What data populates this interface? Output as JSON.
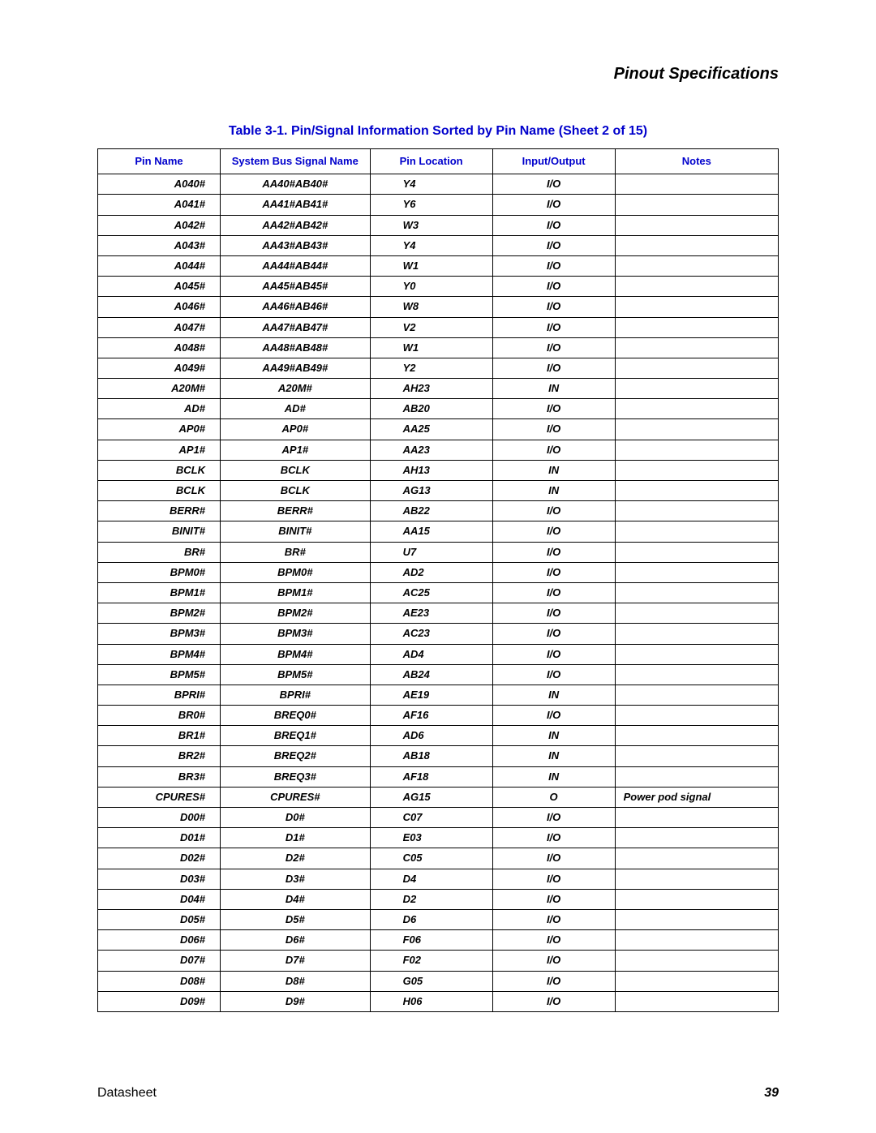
{
  "section_title": "Pinout Specifications",
  "table_caption": "Table 3-1. Pin/Signal Information Sorted by Pin Name (Sheet 2 of 15)",
  "headers": {
    "pin_name": "Pin Name",
    "signal": "System Bus Signal Name",
    "location": "Pin Location",
    "io": "Input/Output",
    "notes": "Notes"
  },
  "footer": {
    "left": "Datasheet",
    "right": "39"
  },
  "rows": [
    {
      "pin": "A040#",
      "sig": "AA40#AB40#",
      "loc": "Y4",
      "io": "I/O",
      "notes": ""
    },
    {
      "pin": "A041#",
      "sig": "AA41#AB41#",
      "loc": "Y6",
      "io": "I/O",
      "notes": ""
    },
    {
      "pin": "A042#",
      "sig": "AA42#AB42#",
      "loc": "W3",
      "io": "I/O",
      "notes": ""
    },
    {
      "pin": "A043#",
      "sig": "AA43#AB43#",
      "loc": "Y4",
      "io": "I/O",
      "notes": ""
    },
    {
      "pin": "A044#",
      "sig": "AA44#AB44#",
      "loc": "W1",
      "io": "I/O",
      "notes": ""
    },
    {
      "pin": "A045#",
      "sig": "AA45#AB45#",
      "loc": "Y0",
      "io": "I/O",
      "notes": ""
    },
    {
      "pin": "A046#",
      "sig": "AA46#AB46#",
      "loc": "W8",
      "io": "I/O",
      "notes": ""
    },
    {
      "pin": "A047#",
      "sig": "AA47#AB47#",
      "loc": "V2",
      "io": "I/O",
      "notes": ""
    },
    {
      "pin": "A048#",
      "sig": "AA48#AB48#",
      "loc": "W1",
      "io": "I/O",
      "notes": ""
    },
    {
      "pin": "A049#",
      "sig": "AA49#AB49#",
      "loc": "Y2",
      "io": "I/O",
      "notes": ""
    },
    {
      "pin": "A20M#",
      "sig": "A20M#",
      "loc": "AH23",
      "io": "IN",
      "notes": ""
    },
    {
      "pin": "AD#",
      "sig": "AD#",
      "loc": "AB20",
      "io": "I/O",
      "notes": ""
    },
    {
      "pin": "AP0#",
      "sig": "AP0#",
      "loc": "AA25",
      "io": "I/O",
      "notes": ""
    },
    {
      "pin": "AP1#",
      "sig": "AP1#",
      "loc": "AA23",
      "io": "I/O",
      "notes": ""
    },
    {
      "pin": "BCLK",
      "sig": "BCLK",
      "loc": "AH13",
      "io": "IN",
      "notes": ""
    },
    {
      "pin": "BCLK",
      "sig": "BCLK",
      "loc": "AG13",
      "io": "IN",
      "notes": ""
    },
    {
      "pin": "BERR#",
      "sig": "BERR#",
      "loc": "AB22",
      "io": "I/O",
      "notes": ""
    },
    {
      "pin": "BINIT#",
      "sig": "BINIT#",
      "loc": "AA15",
      "io": "I/O",
      "notes": ""
    },
    {
      "pin": "BR#",
      "sig": "BR#",
      "loc": "U7",
      "io": "I/O",
      "notes": ""
    },
    {
      "pin": "BPM0#",
      "sig": "BPM0#",
      "loc": "AD2",
      "io": "I/O",
      "notes": ""
    },
    {
      "pin": "BPM1#",
      "sig": "BPM1#",
      "loc": "AC25",
      "io": "I/O",
      "notes": ""
    },
    {
      "pin": "BPM2#",
      "sig": "BPM2#",
      "loc": "AE23",
      "io": "I/O",
      "notes": ""
    },
    {
      "pin": "BPM3#",
      "sig": "BPM3#",
      "loc": "AC23",
      "io": "I/O",
      "notes": ""
    },
    {
      "pin": "BPM4#",
      "sig": "BPM4#",
      "loc": "AD4",
      "io": "I/O",
      "notes": ""
    },
    {
      "pin": "BPM5#",
      "sig": "BPM5#",
      "loc": "AB24",
      "io": "I/O",
      "notes": ""
    },
    {
      "pin": "BPRI#",
      "sig": "BPRI#",
      "loc": "AE19",
      "io": "IN",
      "notes": ""
    },
    {
      "pin": "BR0#",
      "sig": "BREQ0#",
      "loc": "AF16",
      "io": "I/O",
      "notes": ""
    },
    {
      "pin": "BR1#",
      "sig": "BREQ1#",
      "loc": "AD6",
      "io": "IN",
      "notes": ""
    },
    {
      "pin": "BR2#",
      "sig": "BREQ2#",
      "loc": "AB18",
      "io": "IN",
      "notes": ""
    },
    {
      "pin": "BR3#",
      "sig": "BREQ3#",
      "loc": "AF18",
      "io": "IN",
      "notes": ""
    },
    {
      "pin": "CPURES#",
      "sig": "CPURES#",
      "loc": "AG15",
      "io": "O",
      "notes": "Power pod signal"
    },
    {
      "pin": "D00#",
      "sig": "D0#",
      "loc": "C07",
      "io": "I/O",
      "notes": ""
    },
    {
      "pin": "D01#",
      "sig": "D1#",
      "loc": "E03",
      "io": "I/O",
      "notes": ""
    },
    {
      "pin": "D02#",
      "sig": "D2#",
      "loc": "C05",
      "io": "I/O",
      "notes": ""
    },
    {
      "pin": "D03#",
      "sig": "D3#",
      "loc": "D4",
      "io": "I/O",
      "notes": ""
    },
    {
      "pin": "D04#",
      "sig": "D4#",
      "loc": "D2",
      "io": "I/O",
      "notes": ""
    },
    {
      "pin": "D05#",
      "sig": "D5#",
      "loc": "D6",
      "io": "I/O",
      "notes": ""
    },
    {
      "pin": "D06#",
      "sig": "D6#",
      "loc": "F06",
      "io": "I/O",
      "notes": ""
    },
    {
      "pin": "D07#",
      "sig": "D7#",
      "loc": "F02",
      "io": "I/O",
      "notes": ""
    },
    {
      "pin": "D08#",
      "sig": "D8#",
      "loc": "G05",
      "io": "I/O",
      "notes": ""
    },
    {
      "pin": "D09#",
      "sig": "D9#",
      "loc": "H06",
      "io": "I/O",
      "notes": ""
    }
  ]
}
